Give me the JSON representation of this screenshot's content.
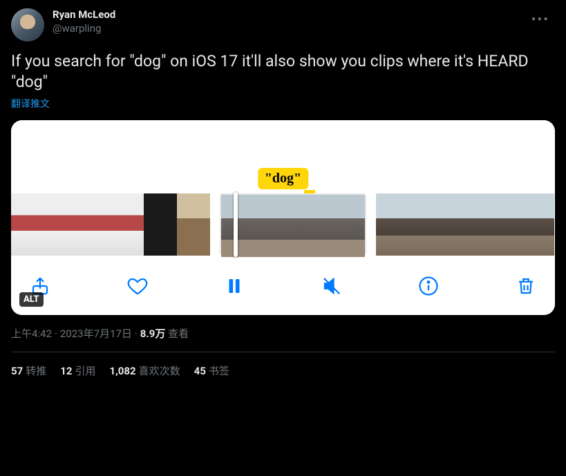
{
  "author": {
    "display_name": "Ryan McLeod",
    "handle": "@warpling"
  },
  "tweet_text": "If you search for \"dog\" on iOS 17 it'll also show you clips where it's HEARD \"dog\"",
  "translate_label": "翻译推文",
  "media": {
    "search_term_label": "\"dog\"",
    "alt_badge": "ALT",
    "toolbar_icons": [
      "share",
      "heart",
      "pause",
      "mute",
      "info",
      "trash"
    ]
  },
  "meta": {
    "time": "上午4:42",
    "date": "2023年7月17日",
    "views_count": "8.9万",
    "views_label": "查看"
  },
  "stats": {
    "retweets_count": "57",
    "retweets_label": "转推",
    "quotes_count": "12",
    "quotes_label": "引用",
    "likes_count": "1,082",
    "likes_label": "喜欢次数",
    "bookmarks_count": "45",
    "bookmarks_label": "书签"
  }
}
